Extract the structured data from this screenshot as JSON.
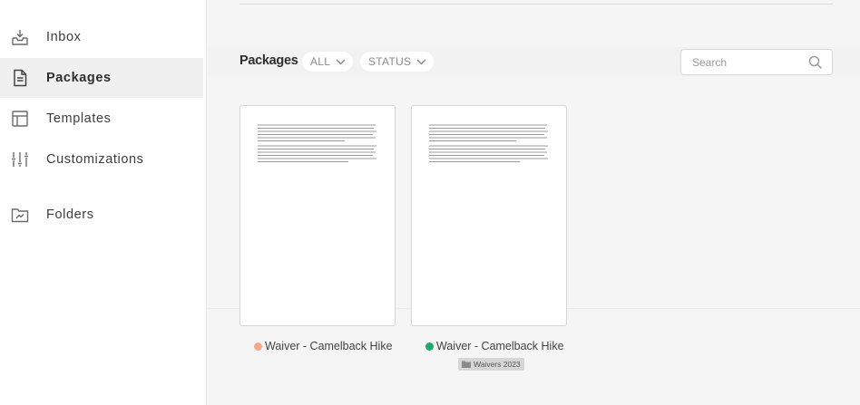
{
  "sidebar": {
    "items": [
      {
        "label": "Inbox",
        "icon": "inbox-icon",
        "active": false
      },
      {
        "label": "Packages",
        "icon": "document-icon",
        "active": true
      },
      {
        "label": "Templates",
        "icon": "template-icon",
        "active": false
      },
      {
        "label": "Customizations",
        "icon": "sliders-icon",
        "active": false
      },
      {
        "label": "Folders",
        "icon": "folder-icon",
        "active": false
      }
    ]
  },
  "main": {
    "title": "Packages",
    "filters": [
      {
        "label": "ALL"
      },
      {
        "label": "STATUS"
      }
    ],
    "search": {
      "placeholder": "Search",
      "value": ""
    },
    "packages": [
      {
        "name": "Waiver - Camelback Hike",
        "status_color": "#f4a98a",
        "folder": ""
      },
      {
        "name": "Waiver - Camelback Hike",
        "status_color": "#1faa6b",
        "folder": "Waivers 2023"
      }
    ]
  },
  "colors": {
    "sidebar_bg": "#ffffff",
    "sidebar_active_bg": "#f0f0f0",
    "main_bg": "#f5f5f5",
    "draft_dot": "#f4a98a",
    "complete_dot": "#1faa6b"
  }
}
